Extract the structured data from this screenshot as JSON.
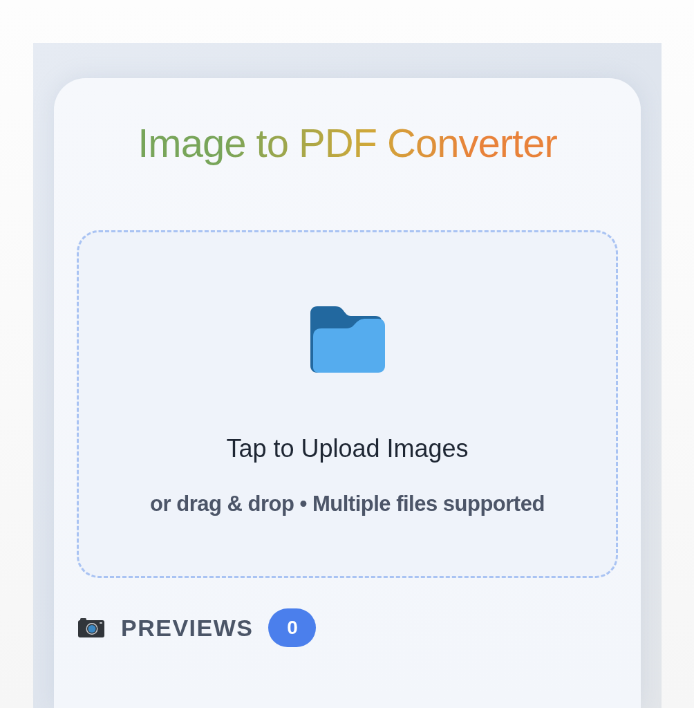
{
  "title": "Image to PDF Converter",
  "upload": {
    "heading": "Tap to Upload Images",
    "hint": "or drag & drop • Multiple files supported"
  },
  "previews": {
    "label": "PREVIEWS",
    "count": "0"
  }
}
